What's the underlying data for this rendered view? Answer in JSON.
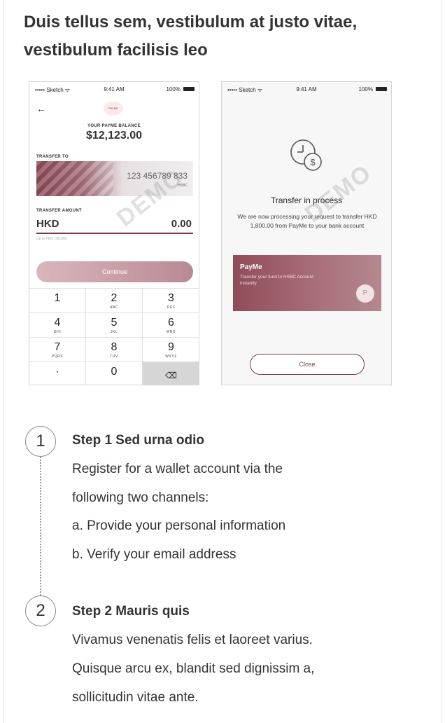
{
  "heading": "Duis tellus sem, vestibulum at justo vitae, vestibulum facilisis leo",
  "phone1": {
    "status": {
      "carrier": "••••• Sketch ᯤ",
      "time": "9:41 AM",
      "battery": "100%"
    },
    "logo_text": "PAYME",
    "balance_label": "YOUR PAYME BALANCE",
    "balance_value": "$12,123.00",
    "transfer_to_label": "TRANSFER TO",
    "card_number": "123 456789 833",
    "card_bank": "HSBC",
    "transfer_amount_label": "TRANSFER AMOUNT",
    "currency": "HKD",
    "amount": "0.00",
    "amount_hint": "Up to HKD 100,000",
    "continue_label": "Continue",
    "watermark": "DEMO",
    "keys": [
      {
        "d": "1",
        "l": ""
      },
      {
        "d": "2",
        "l": "ABC"
      },
      {
        "d": "3",
        "l": "DEF"
      },
      {
        "d": "4",
        "l": "GHI"
      },
      {
        "d": "5",
        "l": "JKL"
      },
      {
        "d": "6",
        "l": "MNO"
      },
      {
        "d": "7",
        "l": "PQRS"
      },
      {
        "d": "8",
        "l": "TUV"
      },
      {
        "d": "9",
        "l": "WXYZ"
      },
      {
        "d": "·",
        "l": ""
      },
      {
        "d": "0",
        "l": ""
      },
      {
        "d": "⌫",
        "l": ""
      }
    ]
  },
  "phone2": {
    "status": {
      "carrier": "••••• Sketch ᯤ",
      "time": "9:41 AM",
      "battery": "100%"
    },
    "title": "Transfer in process",
    "message": "We are now processing your request to transfer HKD 1,800.00 from PayMe to your bank account",
    "card_title": "PayMe",
    "card_sub": "Transfer your fund to HSBC Account instantly",
    "card_logo": "P",
    "close_label": "Close",
    "watermark": "DEMO"
  },
  "steps": [
    {
      "number": "1",
      "title": "Step 1 Sed urna odio",
      "lines": [
        "Register for a wallet account via the",
        "following two channels:",
        "a. Provide your personal information",
        "b. Verify your email address"
      ]
    },
    {
      "number": "2",
      "title": "Step 2 Mauris quis",
      "lines": [
        "Vivamus venenatis felis et laoreet varius.",
        "Quisque arcu ex, blandit sed dignissim a,",
        "sollicitudin vitae ante."
      ]
    }
  ],
  "colors": {
    "accent": "#7b3b48",
    "card": "#a66b76"
  }
}
